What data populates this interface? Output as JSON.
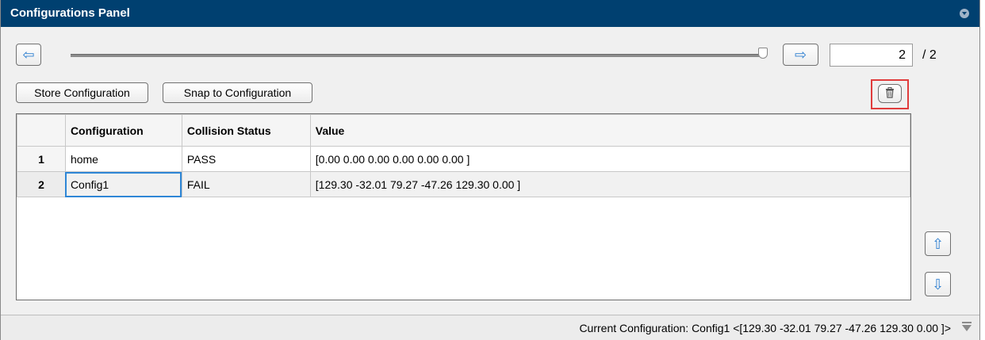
{
  "panel": {
    "title": "Configurations Panel"
  },
  "navigation": {
    "current_page": "2",
    "total_pages": "/ 2",
    "slider_position": 1.0
  },
  "buttons": {
    "store": "Store Configuration",
    "snap": "Snap to Configuration"
  },
  "table": {
    "headers": [
      "",
      "Configuration",
      "Collision Status",
      "Value"
    ],
    "rows": [
      {
        "index": "1",
        "configuration": "home",
        "status": "PASS",
        "value": "[0.00 0.00 0.00 0.00 0.00 0.00 ]"
      },
      {
        "index": "2",
        "configuration": "Config1",
        "status": "FAIL",
        "value": "[129.30 -32.01 79.27 -47.26 129.30 0.00 ]"
      }
    ]
  },
  "status_bar": {
    "text": "Current Configuration: Config1 <[129.30 -32.01 79.27 -47.26 129.30 0.00 ]>"
  },
  "icons": {
    "prev": "left-arrow-icon",
    "next": "right-arrow-icon",
    "delete": "trash-icon",
    "move_up": "up-arrow-icon",
    "move_down": "down-arrow-icon",
    "collapse": "chevron-down-icon"
  },
  "colors": {
    "title_bar": "#004070",
    "arrow": "#2e7fd0",
    "highlight": "#e03c3c",
    "selection": "#2e86d6"
  }
}
